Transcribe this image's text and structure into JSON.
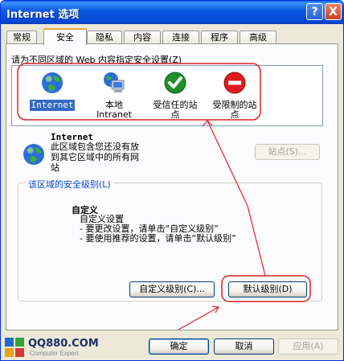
{
  "window": {
    "title": "Internet 选项"
  },
  "title_buttons": {
    "help": "?",
    "close": "X"
  },
  "tabs": [
    {
      "label": "常规"
    },
    {
      "label": "安全"
    },
    {
      "label": "隐私"
    },
    {
      "label": "内容"
    },
    {
      "label": "连接"
    },
    {
      "label": "程序"
    },
    {
      "label": "高级"
    }
  ],
  "active_tab": "安全",
  "zones": {
    "label": "请为不同区域的 Web 内容指定安全设置(Z)",
    "items": [
      {
        "label": "Internet",
        "icon": "globe-icon",
        "selected": true
      },
      {
        "label": "本地\nIntranet",
        "icon": "intranet-computer-icon"
      },
      {
        "label": "受信任的站\n点",
        "icon": "trusted-check-icon"
      },
      {
        "label": "受限制的站\n点",
        "icon": "restricted-no-entry-icon"
      }
    ]
  },
  "zone_info": {
    "title": "Internet",
    "description": "此区域包含您还没有放到其它区域中的所有网站",
    "sites_button": "站点(S)..."
  },
  "security_level": {
    "group_label": "该区域的安全级别(L)",
    "title": "自定义",
    "lines": [
      "自定义设置",
      "- 要更改设置，请单击“自定义级别”",
      "- 要使用推荐的设置，请单击“默认级别”"
    ],
    "custom_button": "自定义级别(C)...",
    "default_button": "默认级别(D)"
  },
  "footer": {
    "ok": "确定",
    "cancel": "取消",
    "apply": "应用(A)"
  },
  "watermark": {
    "name": "QQ880.COM",
    "tagline": "Computer Expert"
  },
  "colors": {
    "titlebar": "#0a5fe8",
    "annotation": "#e02020",
    "selection": "#316ac5"
  }
}
